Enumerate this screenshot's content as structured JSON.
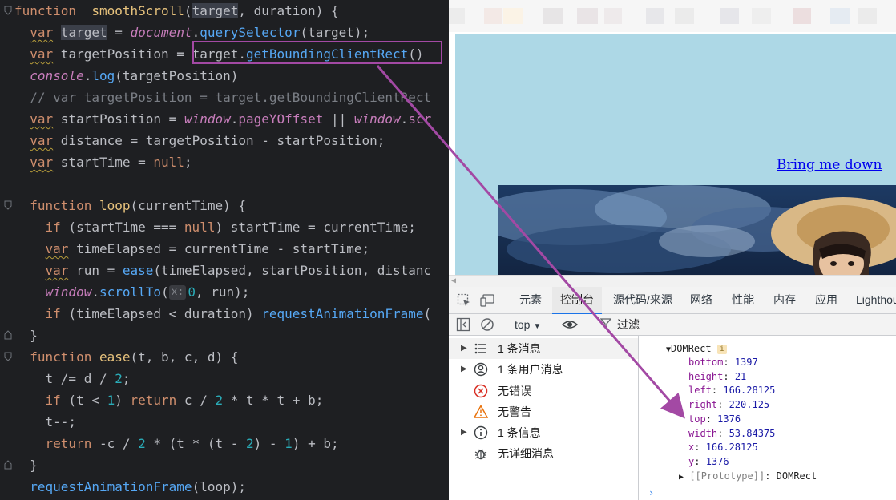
{
  "editor": {
    "lines": [
      {
        "tokens": [
          [
            "kw",
            "function"
          ],
          [
            "",
            "  "
          ],
          [
            "fnd",
            "smoothScroll"
          ],
          [
            "",
            "("
          ],
          [
            "hlbg",
            "target"
          ],
          [
            "",
            ", duration) {"
          ]
        ]
      },
      {
        "tokens": [
          [
            "",
            "  "
          ],
          [
            "kw var",
            "var"
          ],
          [
            "",
            " "
          ],
          [
            "hlbg",
            "target"
          ],
          [
            "",
            " = "
          ],
          [
            "prop ital",
            "document"
          ],
          [
            "",
            "."
          ],
          [
            "fn",
            "querySelector"
          ],
          [
            "",
            "(target);"
          ]
        ]
      },
      {
        "tokens": [
          [
            "",
            "  "
          ],
          [
            "kw var",
            "var"
          ],
          [
            "",
            " targetPosition = "
          ],
          [
            "",
            ""
          ],
          [
            "",
            "target."
          ],
          [
            "fn",
            "getBoundingClientRect"
          ],
          [
            "",
            "()"
          ]
        ]
      },
      {
        "tokens": [
          [
            "",
            "  "
          ],
          [
            "prop ital",
            "console"
          ],
          [
            "",
            "."
          ],
          [
            "fn",
            "log"
          ],
          [
            "",
            "(targetPosition)"
          ]
        ]
      },
      {
        "tokens": [
          [
            "cmt",
            "  // var targetPosition = target.getBoundingClientRect"
          ]
        ]
      },
      {
        "tokens": [
          [
            "",
            "  "
          ],
          [
            "kw var",
            "var"
          ],
          [
            "",
            " startPosition = "
          ],
          [
            "prop ital",
            "window"
          ],
          [
            "",
            "."
          ],
          [
            "prop strike",
            "pageYOffset"
          ],
          [
            "",
            " || "
          ],
          [
            "prop ital",
            "window"
          ],
          [
            "",
            "."
          ],
          [
            "prop",
            "scr"
          ]
        ]
      },
      {
        "tokens": [
          [
            "",
            "  "
          ],
          [
            "kw var",
            "var"
          ],
          [
            "",
            " distance = targetPosition - startPosition;"
          ]
        ]
      },
      {
        "tokens": [
          [
            "",
            "  "
          ],
          [
            "kw var",
            "var"
          ],
          [
            "",
            " startTime = "
          ],
          [
            "kw",
            "null"
          ],
          [
            "",
            ";"
          ]
        ]
      },
      {
        "tokens": [
          [
            "",
            ""
          ]
        ]
      },
      {
        "tokens": [
          [
            "",
            "  "
          ],
          [
            "kw",
            "function"
          ],
          [
            "",
            " "
          ],
          [
            "fnd",
            "loop"
          ],
          [
            "",
            "(currentTime) {"
          ]
        ]
      },
      {
        "tokens": [
          [
            "",
            "    "
          ],
          [
            "kw",
            "if"
          ],
          [
            "",
            " (startTime === "
          ],
          [
            "kw",
            "null"
          ],
          [
            "",
            ") startTime = currentTime;"
          ]
        ]
      },
      {
        "tokens": [
          [
            "",
            "    "
          ],
          [
            "kw var",
            "var"
          ],
          [
            "",
            " timeElapsed = currentTime - startTime;"
          ]
        ]
      },
      {
        "tokens": [
          [
            "",
            "    "
          ],
          [
            "kw var",
            "var"
          ],
          [
            "",
            " run = "
          ],
          [
            "fn",
            "ease"
          ],
          [
            "",
            "(timeElapsed, startPosition, distanc"
          ]
        ]
      },
      {
        "tokens": [
          [
            "",
            "    "
          ],
          [
            "prop ital",
            "window"
          ],
          [
            "",
            "."
          ],
          [
            "fn",
            "scrollTo"
          ],
          [
            "",
            "("
          ],
          [
            "hint",
            "x:"
          ],
          [
            "num",
            "0"
          ],
          [
            "",
            ", run);"
          ]
        ]
      },
      {
        "tokens": [
          [
            "",
            "    "
          ],
          [
            "kw",
            "if"
          ],
          [
            "",
            " (timeElapsed < duration) "
          ],
          [
            "fn",
            "requestAnimationFrame"
          ],
          [
            "",
            "("
          ]
        ]
      },
      {
        "tokens": [
          [
            "",
            "  }"
          ]
        ]
      },
      {
        "tokens": [
          [
            "",
            "  "
          ],
          [
            "kw",
            "function"
          ],
          [
            "",
            " "
          ],
          [
            "fnd",
            "ease"
          ],
          [
            "",
            "(t, b, c, d) {"
          ]
        ]
      },
      {
        "tokens": [
          [
            "",
            "    t /= d / "
          ],
          [
            "num",
            "2"
          ],
          [
            "",
            ";"
          ]
        ]
      },
      {
        "tokens": [
          [
            "",
            "    "
          ],
          [
            "kw",
            "if"
          ],
          [
            "",
            " (t < "
          ],
          [
            "num",
            "1"
          ],
          [
            "",
            ") "
          ],
          [
            "kw",
            "return"
          ],
          [
            "",
            " c / "
          ],
          [
            "num",
            "2"
          ],
          [
            "",
            " * t * t + b;"
          ]
        ]
      },
      {
        "tokens": [
          [
            "",
            "    t--;"
          ]
        ]
      },
      {
        "tokens": [
          [
            "",
            "    "
          ],
          [
            "kw",
            "return"
          ],
          [
            "",
            " -c / "
          ],
          [
            "num",
            "2"
          ],
          [
            "",
            " * (t * (t - "
          ],
          [
            "num",
            "2"
          ],
          [
            "",
            ") - "
          ],
          [
            "num",
            "1"
          ],
          [
            "",
            ") + b;"
          ]
        ]
      },
      {
        "tokens": [
          [
            "",
            "  }"
          ]
        ]
      },
      {
        "tokens": [
          [
            "",
            "  "
          ],
          [
            "fn",
            "requestAnimationFrame"
          ],
          [
            "",
            "(loop);"
          ]
        ]
      }
    ]
  },
  "page": {
    "link_text": "Bring me down"
  },
  "devtools": {
    "tabs": [
      "元素",
      "控制台",
      "源代码/来源",
      "网络",
      "性能",
      "内存",
      "应用",
      "Lighthouse"
    ],
    "active_tab": "控制台",
    "context": "top",
    "filter_placeholder": "过滤",
    "sidebar": [
      {
        "label": "1 条消息",
        "icon": "list-icon",
        "expandable": true
      },
      {
        "label": "1 条用户消息",
        "icon": "user-icon",
        "expandable": true
      },
      {
        "label": "无错误",
        "icon": "error-icon",
        "expandable": false
      },
      {
        "label": "无警告",
        "icon": "warning-icon",
        "expandable": false
      },
      {
        "label": "1 条信息",
        "icon": "info-icon",
        "expandable": true
      },
      {
        "label": "无详细消息",
        "icon": "bug-icon",
        "expandable": false
      }
    ],
    "console": {
      "object_name": "DOMRect",
      "badge": "i",
      "props": [
        {
          "key": "bottom",
          "value": "1397"
        },
        {
          "key": "height",
          "value": "21"
        },
        {
          "key": "left",
          "value": "166.28125"
        },
        {
          "key": "right",
          "value": "220.125"
        },
        {
          "key": "top",
          "value": "1376"
        },
        {
          "key": "width",
          "value": "53.84375"
        },
        {
          "key": "x",
          "value": "166.28125"
        },
        {
          "key": "y",
          "value": "1376"
        }
      ],
      "prototype_key": "[[Prototype]]",
      "prototype_value": "DOMRect",
      "prompt": "›"
    }
  },
  "colors": {
    "annotation": "#a349a4",
    "page_bg": "#add8e6",
    "link": "#0000ee"
  }
}
